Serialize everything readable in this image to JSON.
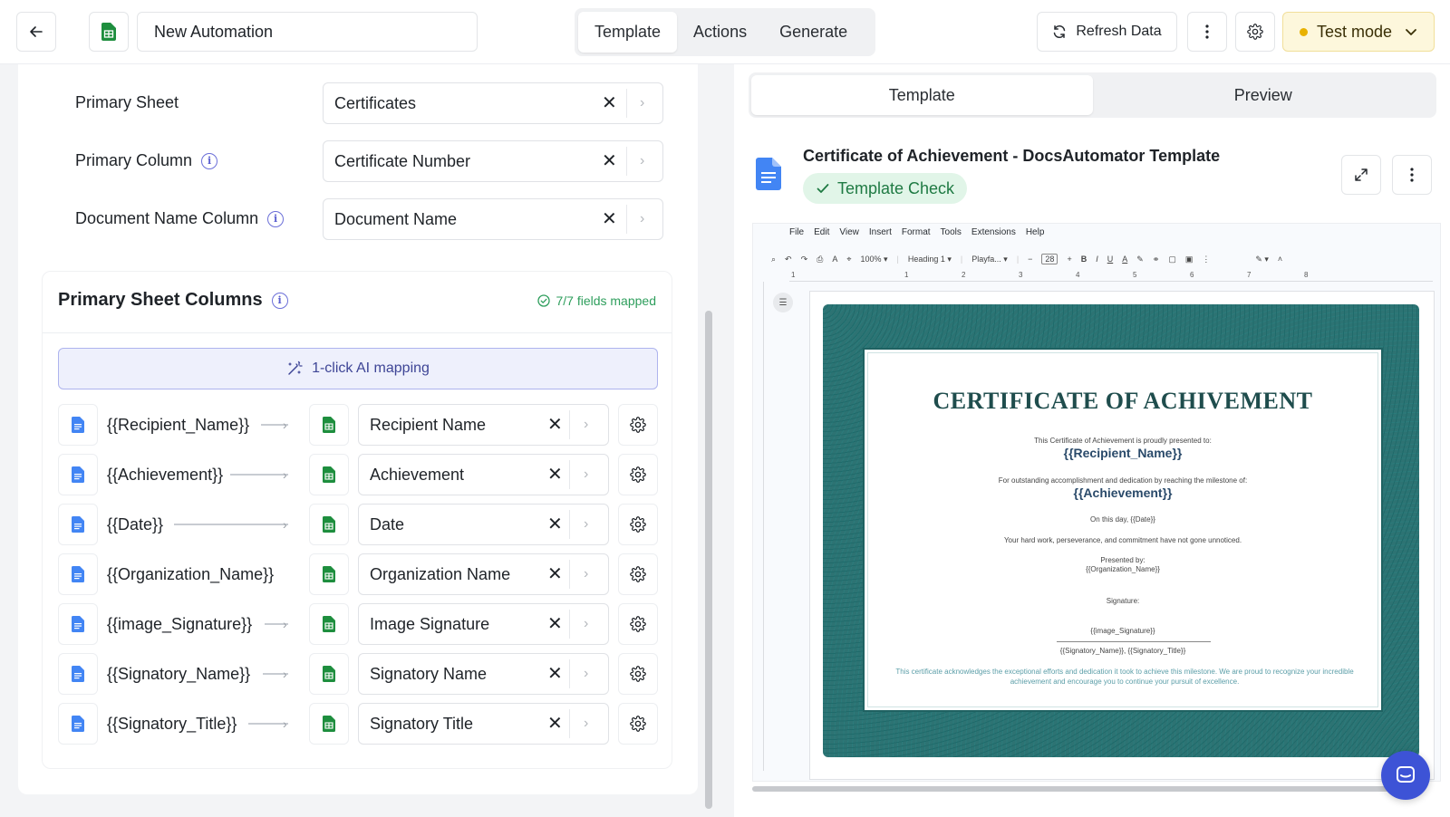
{
  "topbar": {
    "automation_name": "New Automation",
    "mode_tabs": [
      "Template",
      "Actions",
      "Generate"
    ],
    "active_mode_tab": "Template",
    "refresh_label": "Refresh Data",
    "test_mode_label": "Test mode"
  },
  "config": {
    "fields": [
      {
        "label": "Primary Sheet",
        "value": "Certificates",
        "has_info": false
      },
      {
        "label": "Primary Column",
        "value": "Certificate Number",
        "has_info": true
      },
      {
        "label": "Document Name Column",
        "value": "Document Name",
        "has_info": true
      }
    ]
  },
  "columns_card": {
    "title": "Primary Sheet Columns",
    "fields_mapped": "7/7 fields mapped",
    "ai_mapping_label": "1-click AI mapping",
    "mappings": [
      {
        "placeholder": "{{Recipient_Name}}",
        "column": "Recipient Name"
      },
      {
        "placeholder": "{{Achievement}}",
        "column": "Achievement"
      },
      {
        "placeholder": "{{Date}}",
        "column": "Date"
      },
      {
        "placeholder": "{{Organization_Name}}",
        "column": "Organization Name"
      },
      {
        "placeholder": "{{image_Signature}}",
        "column": "Image Signature"
      },
      {
        "placeholder": "{{Signatory_Name}}",
        "column": "Signatory Name"
      },
      {
        "placeholder": "{{Signatory_Title}}",
        "column": "Signatory Title"
      }
    ]
  },
  "preview_panel": {
    "tabs": [
      "Template",
      "Preview"
    ],
    "active_tab": "Template",
    "doc_title": "Certificate of Achievement - DocsAutomator Template",
    "template_check_label": "Template Check"
  },
  "gdoc": {
    "menu": [
      "File",
      "Edit",
      "View",
      "Insert",
      "Format",
      "Tools",
      "Extensions",
      "Help"
    ],
    "zoom": "100%",
    "style": "Heading 1",
    "font": "Playfa...",
    "font_size": "28",
    "ruler_marks": [
      "1",
      "1",
      "2",
      "3",
      "4",
      "5",
      "6",
      "7",
      "8"
    ]
  },
  "certificate": {
    "title": "CERTIFICATE OF ACHIVEMENT",
    "presented_line": "This Certificate of Achievement is proudly presented to:",
    "recipient": "{{Recipient_Name}}",
    "milestone_line": "For outstanding accomplishment and dedication by reaching the milestone of:",
    "achievement": "{{Achievement}}",
    "date_line": "On this day, {{Date}}",
    "perseverance_line": "Your hard work, perseverance, and commitment have not gone unnoticed.",
    "presented_by": "Presented by:",
    "organization": "{{Organization_Name}}",
    "signature_label": "Signature:",
    "image_signature": "{{image_Signature}}",
    "signatory": "{{Signatory_Name}}, {{Signatory_Title}}",
    "footer": "This certificate acknowledges the exceptional efforts and dedication it took to achieve this milestone. We are proud to recognize your incredible achievement and encourage you to continue your pursuit of excellence."
  },
  "colors": {
    "accent": "#5b5fd0",
    "success": "#2e9e5c",
    "test_mode_bg": "#fdf7dc",
    "sheets_green": "#1e8e3e",
    "docs_blue": "#4285f4",
    "cert_teal": "#2d7373"
  },
  "icons": {
    "back": "arrow-left-icon",
    "sheets": "google-sheets-icon",
    "docs": "google-docs-icon",
    "refresh": "refresh-icon",
    "more": "more-vertical-icon",
    "settings": "gear-icon",
    "chevron": "chevron-down-icon",
    "clear": "close-icon",
    "open": "chevron-right-icon",
    "magic": "magic-wand-icon",
    "check": "check-icon",
    "expand": "expand-icon",
    "chat": "chat-icon"
  }
}
